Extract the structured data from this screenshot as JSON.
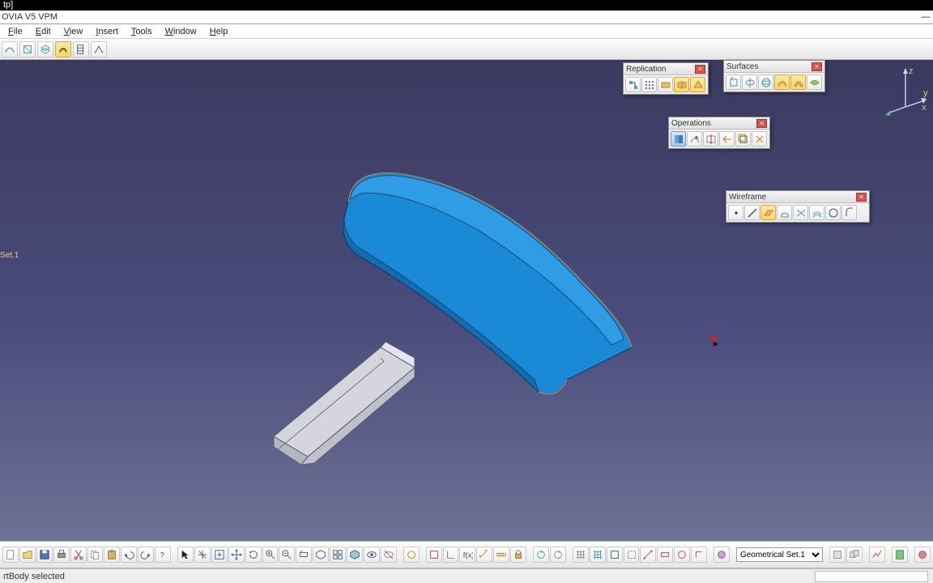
{
  "app": {
    "title_fragment": "tp]",
    "caption_fragment": "OVIA V5 VPM"
  },
  "menu": {
    "file": "File",
    "edit": "Edit",
    "view": "View",
    "insert": "Insert",
    "tools": "Tools",
    "window": "Window",
    "help": "Help"
  },
  "tree": {
    "node": "Set.1"
  },
  "palettes": {
    "replication": {
      "title": "Replication"
    },
    "surfaces": {
      "title": "Surfaces"
    },
    "operations": {
      "title": "Operations"
    },
    "wireframe": {
      "title": "Wireframe"
    }
  },
  "bottom": {
    "combo_value": "Geometrical Set.1"
  },
  "status": {
    "message": "rtBody selected"
  },
  "colors": {
    "viewport_top": "#3b3960",
    "viewport_bot": "#6d7296",
    "solid_blue": "#1a8ad6",
    "solid_grey": "#c8c8d2"
  }
}
